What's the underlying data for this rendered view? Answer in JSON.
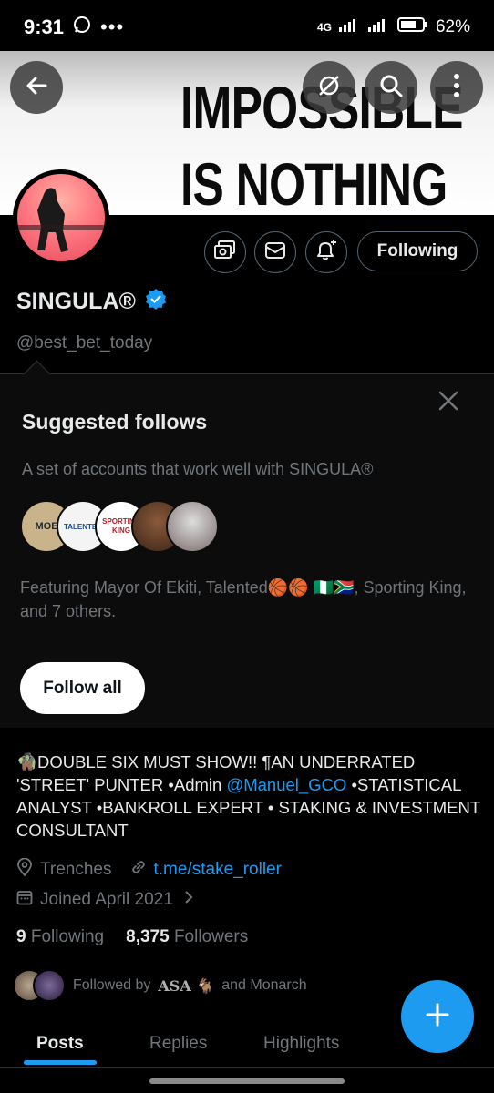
{
  "status_bar": {
    "time": "9:31",
    "network": "4G",
    "battery": "62%"
  },
  "banner": {
    "line1": "IMPOSSIBLE",
    "line2": "IS NOTHING"
  },
  "header_icons": [
    "back-arrow-icon",
    "grok-icon",
    "search-icon",
    "more-icon"
  ],
  "profile": {
    "name": "SINGULA®",
    "handle": "@best_bet_today",
    "follow_button": "Following",
    "verified_color": "#1d9bf0"
  },
  "suggested": {
    "title": "Suggested follows",
    "description": "A set of accounts that work well with SINGULA®",
    "featuring": "Featuring Mayor Of Ekiti, Talented🏀🏀 🇳🇬🇿🇦, Sporting King, and 7 others.",
    "follow_all": "Follow all",
    "face_labels": [
      "MOE",
      "TALENTED",
      "SPORTING KING"
    ]
  },
  "bio": {
    "part1": "🧌DOUBLE SIX MUST SHOW!! ¶AN UNDERRATED 'STREET' PUNTER •Admin ",
    "mention": "@Manuel_GCO",
    "part2": " •STATISTICAL ANALYST •BANKROLL EXPERT • STAKING & INVESTMENT CONSULTANT"
  },
  "meta": {
    "location": "Trenches",
    "link": "t.me/stake_roller",
    "joined": "Joined April 2021"
  },
  "counts": {
    "following_count": "9",
    "following_label": "Following",
    "followers_count": "8,375",
    "followers_label": "Followers"
  },
  "followed_by": {
    "prefix": "Followed by",
    "name1": "ASA 🐐",
    "suffix": "and Monarch"
  },
  "tabs": [
    "Posts",
    "Replies",
    "Highlights"
  ],
  "accent_color": "#1d9bf0"
}
